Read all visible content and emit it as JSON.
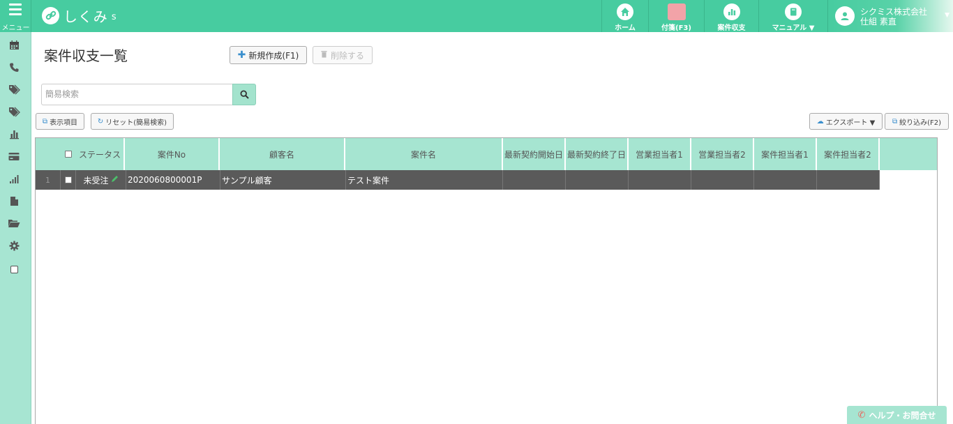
{
  "header": {
    "menu_label": "メニュー",
    "logo_text": "しくみ",
    "logo_sub": "s",
    "nav": [
      {
        "label": "ホーム",
        "icon": "home-icon"
      },
      {
        "label": "付箋(F3)",
        "icon": "sticky-note-icon"
      },
      {
        "label": "案件収支",
        "icon": "bar-chart-icon"
      },
      {
        "label": "マニュアル ▼",
        "icon": "book-icon"
      }
    ],
    "user": {
      "company": "シクミス株式会社",
      "name": "仕組 素直"
    }
  },
  "sidebar": {
    "items": [
      "calendar-icon",
      "phone-icon",
      "tag-icon",
      "tags-icon",
      "bar-chart-icon",
      "credit-card-icon",
      "signal-icon",
      "file-icon",
      "folder-open-icon",
      "gear-icon",
      "checkbox-icon"
    ]
  },
  "page": {
    "title": "案件収支一覧",
    "new_button": "新規作成(F1)",
    "delete_button": "削除する",
    "search_placeholder": "簡易検索",
    "display_items_button": "表示項目",
    "reset_button": "リセット(簡易検索)",
    "export_button": "エクスポート ▼",
    "filter_button": "絞り込み(F2)"
  },
  "table": {
    "columns": [
      "ステータス",
      "案件No",
      "顧客名",
      "案件名",
      "最新契約開始日",
      "最新契約終了日",
      "営業担当者1",
      "営業担当者2",
      "案件担当者1",
      "案件担当者2"
    ],
    "rows": [
      {
        "index": "1",
        "status": "未受注",
        "no": "2020060800001P",
        "customer": "サンプル顧客",
        "project": "テスト案件",
        "start": "",
        "end": "",
        "sales1": "",
        "sales2": "",
        "pm1": "",
        "pm2": ""
      }
    ]
  },
  "help_button": "ヘルプ・お問合せ",
  "colors": {
    "brand": "#47cca0",
    "sidebar": "#a7e5d2",
    "grid_header": "#a6e5d1",
    "row_selected": "#5a5a5a",
    "accent_blue": "#3a8fcd"
  }
}
